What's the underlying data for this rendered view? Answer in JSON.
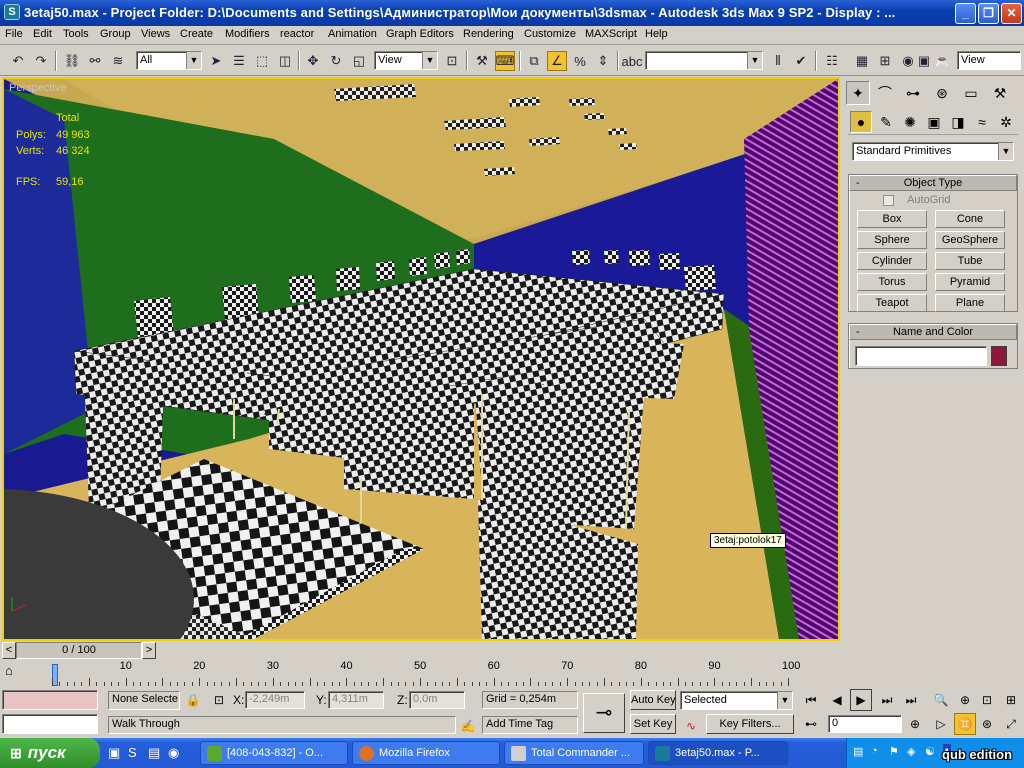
{
  "window": {
    "title": "3etaj50.max    - Project Folder: D:\\Documents and Settings\\Администратор\\Мои документы\\3dsmax    - Autodesk 3ds Max 9 SP2    - Display : ..."
  },
  "menu": [
    "File",
    "Edit",
    "Tools",
    "Group",
    "Views",
    "Create",
    "Modifiers",
    "reactor",
    "Animation",
    "Graph Editors",
    "Rendering",
    "Customize",
    "MAXScript",
    "Help"
  ],
  "toolbar": {
    "selection_filter": "All",
    "ref_coord": "View",
    "named_selection": "",
    "render_preset": "View"
  },
  "viewport": {
    "label": "Perspective",
    "stats_header": "Total",
    "polys_label": "Polys:",
    "polys_value": "49 963",
    "verts_label": "Verts:",
    "verts_value": "46 324",
    "fps_label": "FPS:",
    "fps_value": "59,16",
    "tooltip": "3etaj:potolok17"
  },
  "command_panel": {
    "category": "Standard Primitives",
    "object_type_title": "Object Type",
    "autogrid_label": "AutoGrid",
    "primitives": [
      "Box",
      "Cone",
      "Sphere",
      "GeoSphere",
      "Cylinder",
      "Tube",
      "Torus",
      "Pyramid",
      "Teapot",
      "Plane"
    ],
    "name_color_title": "Name and Color",
    "object_name": "",
    "object_color": "#8b1a3a"
  },
  "timeline": {
    "position": "0 / 100",
    "ticks": [
      "0",
      "10",
      "20",
      "30",
      "40",
      "50",
      "60",
      "70",
      "80",
      "90",
      "100"
    ]
  },
  "status": {
    "selection_text": "None Selecte",
    "prompt": "Walk Through",
    "x_label": "X:",
    "x_value": "-2,249m",
    "y_label": "Y:",
    "y_value": "4,311m",
    "z_label": "Z:",
    "z_value": "0,0m",
    "grid": "Grid = 0,254m",
    "add_time_tag": "Add Time Tag",
    "auto_key": "Auto Key",
    "set_key": "Set Key",
    "key_filter_mode": "Selected",
    "key_filters": "Key Filters...",
    "current_frame": "0"
  },
  "taskbar": {
    "start": "пуск",
    "tasks": [
      "[408-043-832] - О...",
      "Mozilla Firefox",
      "Total Commander ...",
      "3etaj50.max - P..."
    ]
  },
  "watermark": "qub edition"
}
